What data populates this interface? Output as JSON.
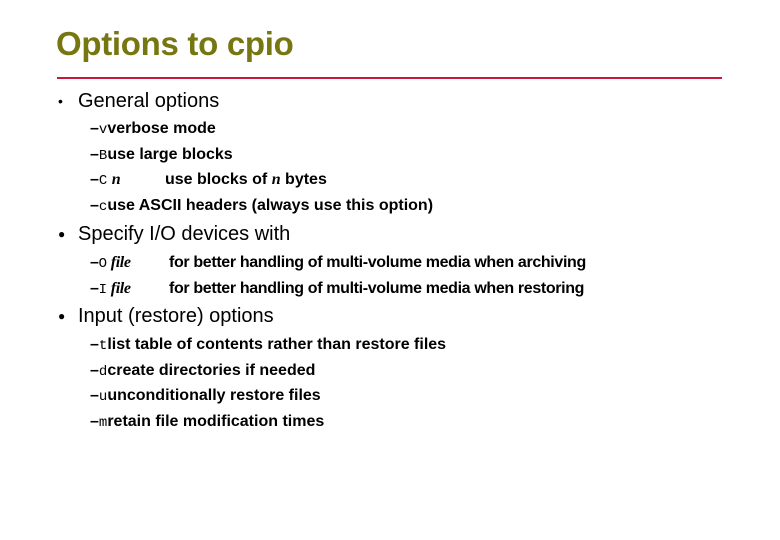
{
  "title": "Options to cpio",
  "colors": {
    "title": "#777712",
    "rule": "#c8193c",
    "text": "#000000"
  },
  "sections": [
    {
      "bullet_icon": "small-dot",
      "heading": "General options",
      "items": [
        {
          "dash": "–",
          "flag": "v",
          "arg": "",
          "desc": "verbose mode"
        },
        {
          "dash": "–",
          "flag": "B",
          "arg": "",
          "desc": "use large blocks"
        },
        {
          "dash": "–",
          "flag": "C",
          "arg": "n",
          "desc": "use blocks of ",
          "desc_arg": "n",
          "desc_tail": " bytes"
        },
        {
          "dash": "–",
          "flag": "c",
          "arg": "",
          "desc": "use ASCII headers (always use this option)"
        }
      ]
    },
    {
      "bullet_icon": "filled-dot",
      "heading": "Specify I/O devices with",
      "items": [
        {
          "dash": "–",
          "flag": "O",
          "arg": "file",
          "desc": "for better handling of multi-volume media when archiving"
        },
        {
          "dash": "–",
          "flag": "I",
          "arg": "file",
          "desc": "for better handling of multi-volume media when restoring"
        }
      ]
    },
    {
      "bullet_icon": "filled-dot",
      "heading": "Input (restore) options",
      "items": [
        {
          "dash": "–",
          "flag": "t",
          "arg": "",
          "desc": "list table of contents rather than restore files"
        },
        {
          "dash": "–",
          "flag": "d",
          "arg": "",
          "desc": "create directories if needed"
        },
        {
          "dash": "–",
          "flag": "u",
          "arg": "",
          "desc": "unconditionally restore files"
        },
        {
          "dash": "–",
          "flag": "m",
          "arg": "",
          "desc": "retain file modification times"
        }
      ]
    }
  ],
  "bullet_glyphs": {
    "small-dot": "•",
    "filled-dot": "●"
  }
}
